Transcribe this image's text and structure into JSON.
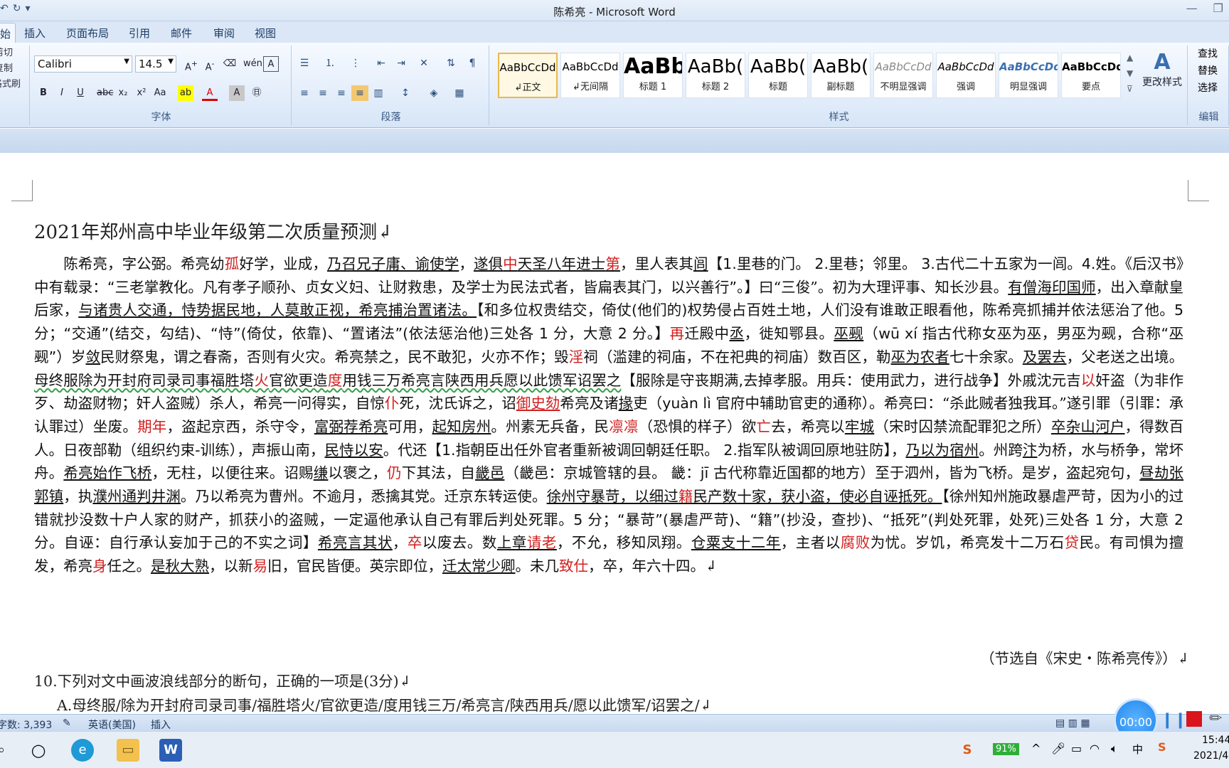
{
  "window": {
    "title": "陈希亮 - Microsoft Word"
  },
  "tabs": [
    "开始",
    "插入",
    "页面布局",
    "引用",
    "邮件",
    "审阅",
    "视图"
  ],
  "clipboard": {
    "cut": "剪切",
    "copy": "复制",
    "painter": "格式刷"
  },
  "font": {
    "name": "Calibri",
    "size": "14.5",
    "group_label": "字体"
  },
  "paragraph": {
    "group_label": "段落"
  },
  "styles": {
    "group_label": "样式",
    "change_label": "更改样式",
    "items": [
      {
        "sample": "AaBbCcDd",
        "name": "↲正文"
      },
      {
        "sample": "AaBbCcDd",
        "name": "↲无间隔"
      },
      {
        "sample": "AaBb",
        "name": "标题 1"
      },
      {
        "sample": "AaBb(",
        "name": "标题 2"
      },
      {
        "sample": "AaBb(",
        "name": "标题"
      },
      {
        "sample": "AaBb(",
        "name": "副标题"
      },
      {
        "sample": "AaBbCcDd",
        "name": "不明显强调"
      },
      {
        "sample": "AaBbCcDd",
        "name": "强调"
      },
      {
        "sample": "AaBbCcDd",
        "name": "明显强调"
      },
      {
        "sample": "AaBbCcDd",
        "name": "要点"
      }
    ]
  },
  "editing": {
    "find": "查找",
    "replace": "替换",
    "select": "选择",
    "group_label": "编辑"
  },
  "document": {
    "title": "2021年郑州高中毕业年级第二次质量预测↲",
    "source": "（节选自《宋史・陈希亮传》）↲",
    "question": "10.下列对文中画波浪线部分的断句，正确的一项是(3分)↲",
    "option_a": "A.母终服/除为开封府司录司事/福胜塔火/官欲更造/度用钱三万/希亮言/陕西用兵/愿以此馈军/诏罢之/↲"
  },
  "statusbar": {
    "words": "字数: 3,393",
    "lang": "英语(美国)",
    "mode": "插入"
  },
  "recorder": {
    "time": "00:00"
  },
  "taskbar": {
    "battery": "91%",
    "time": "15:44",
    "date": "2021/4",
    "ime": "中"
  }
}
